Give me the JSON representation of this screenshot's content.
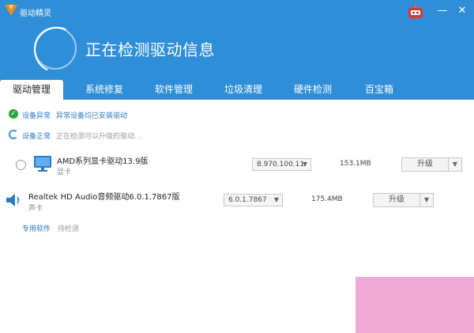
{
  "window": {
    "app_name": "驱动精灵",
    "minimize_glyph": "—",
    "close_glyph": "✕",
    "header_bg": "#2f8ed8"
  },
  "header": {
    "status_title": "正在检测驱动信息"
  },
  "tabs": [
    {
      "label": "驱动管理",
      "active": true
    },
    {
      "label": "系统修复",
      "active": false
    },
    {
      "label": "软件管理",
      "active": false
    },
    {
      "label": "垃圾清理",
      "active": false
    },
    {
      "label": "硬件检测",
      "active": false
    },
    {
      "label": "百宝箱",
      "active": false
    }
  ],
  "status": {
    "abnormal_label": "设备异常",
    "abnormal_detail": "异常设备均已安装驱动",
    "normal_label": "设备正常",
    "normal_detail": "正在检测可以升级的驱动..."
  },
  "drivers": [
    {
      "name": "AMD系列显卡驱动13.9版",
      "type": "显卡",
      "version": "8.970.100.11",
      "size": "153.1MB",
      "action": "升级",
      "icon": "monitor-icon"
    },
    {
      "name": "Realtek HD Audio音频驱动6.0.1.7867版",
      "type": "声卡",
      "version": "6.0.1.7867",
      "size": "175.4MB",
      "action": "升级",
      "icon": "speaker-icon"
    }
  ],
  "footer": {
    "link": "专用软件",
    "status": "待检测"
  },
  "colors": {
    "accent": "#2f8ed8",
    "link": "#2a7bc6",
    "ok_green": "#27a83a"
  }
}
